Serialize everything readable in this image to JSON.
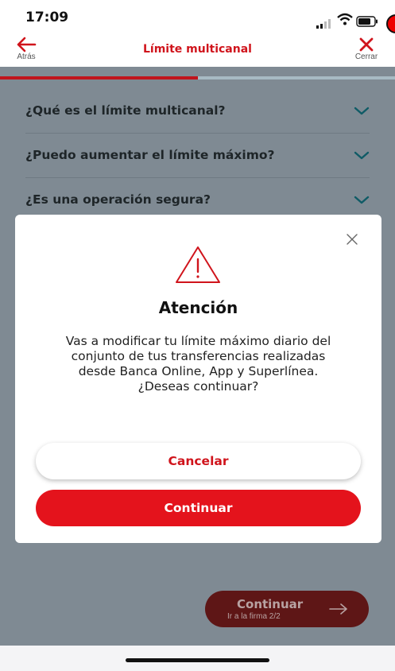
{
  "status_bar": {
    "time": "17:09"
  },
  "header": {
    "back_label": "Atrás",
    "title": "Límite multicanal",
    "close_label": "Cerrar"
  },
  "progress": {
    "fraction": 0.5
  },
  "faq": [
    {
      "question": "¿Qué es el límite multicanal?"
    },
    {
      "question": "¿Puedo aumentar el límite máximo?"
    },
    {
      "question": "¿Es una operación segura?"
    }
  ],
  "footer": {
    "continue_label": "Continuar",
    "continue_sub": "Ir a la firma 2/2"
  },
  "dialog": {
    "title": "Atención",
    "body": "Vas a modificar tu límite máximo diario del conjunto de tus transferencias realizadas desde Banca Online, App y Superlínea. ¿Deseas continuar?",
    "cancel_label": "Cancelar",
    "continue_label": "Continuar"
  },
  "colors": {
    "brand_red": "#e4131c",
    "overlay": "#7f8a93",
    "progress_track": "#a7bac3"
  }
}
